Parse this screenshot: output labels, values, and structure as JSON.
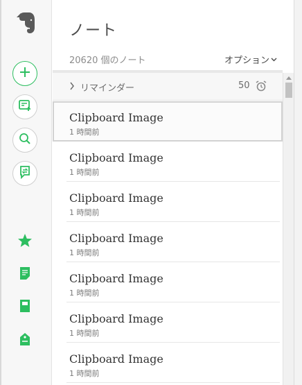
{
  "sidebar": {
    "logo_icon": "evernote-elephant-icon",
    "accent_color": "#2dbe60",
    "buttons": [
      {
        "name": "new-note-button",
        "icon": "plus-icon"
      },
      {
        "name": "new-chat-button",
        "icon": "work-chat-add-icon"
      },
      {
        "name": "search-button",
        "icon": "search-icon"
      },
      {
        "name": "work-chat-button",
        "icon": "work-chat-icon"
      }
    ],
    "nav": [
      {
        "name": "shortcuts",
        "icon": "star-icon"
      },
      {
        "name": "notes",
        "icon": "note-icon"
      },
      {
        "name": "notebooks",
        "icon": "notebook-icon"
      },
      {
        "name": "tags",
        "icon": "tag-icon"
      }
    ]
  },
  "main": {
    "title": "ノート",
    "note_count": "20620 個のノート",
    "options_label": "オプション",
    "reminders": {
      "label": "リマインダー",
      "count": "50",
      "icon": "alarm-clock-icon"
    },
    "notes": [
      {
        "title": "Clipboard Image",
        "time": "1 時間前",
        "selected": true
      },
      {
        "title": "Clipboard Image",
        "time": "1 時間前",
        "selected": false
      },
      {
        "title": "Clipboard Image",
        "time": "1 時間前",
        "selected": false
      },
      {
        "title": "Clipboard Image",
        "time": "1 時間前",
        "selected": false
      },
      {
        "title": "Clipboard Image",
        "time": "1 時間前",
        "selected": false
      },
      {
        "title": "Clipboard Image",
        "time": "1 時間前",
        "selected": false
      },
      {
        "title": "Clipboard Image",
        "time": "1 時間前",
        "selected": false
      }
    ]
  }
}
